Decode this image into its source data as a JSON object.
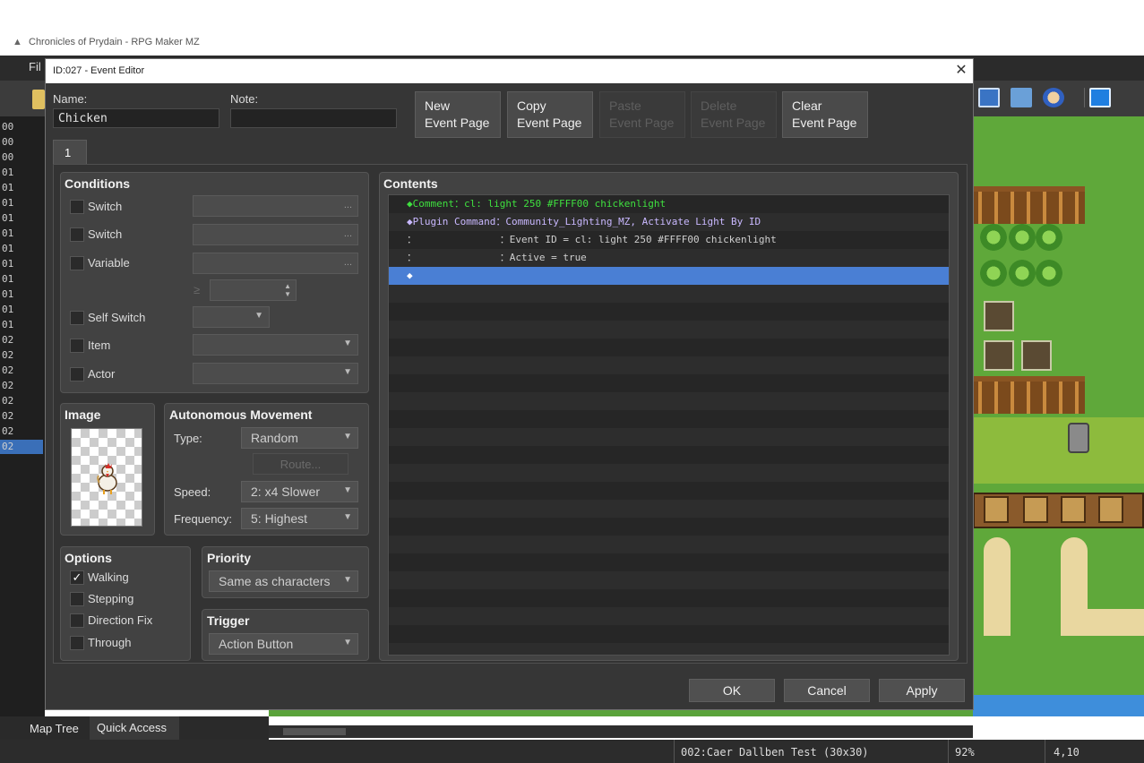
{
  "app": {
    "title": "Chronicles of Prydain - RPG Maker MZ",
    "menu_file": "Fil",
    "map_list": [
      "00",
      "00",
      "00",
      "01",
      "01",
      "01",
      "01",
      "01",
      "01",
      "01",
      "01",
      "01",
      "01",
      "01",
      "02",
      "02",
      "02",
      "02",
      "02",
      "02",
      "02",
      "02"
    ],
    "tabs": {
      "map_tree": "Map Tree",
      "quick_access": "Quick Access"
    },
    "status": {
      "map": "002:Caer Dallben Test (30x30)",
      "zoom": "92%",
      "coords": "4,10"
    }
  },
  "dialog": {
    "title": "ID:027 - Event Editor",
    "close": "✕",
    "name_label": "Name:",
    "name_value": "Chicken",
    "note_label": "Note:",
    "note_value": "",
    "page_buttons": [
      {
        "line1": "New",
        "line2": "Event Page",
        "enabled": true
      },
      {
        "line1": "Copy",
        "line2": "Event Page",
        "enabled": true
      },
      {
        "line1": "Paste",
        "line2": "Event Page",
        "enabled": false
      },
      {
        "line1": "Delete",
        "line2": "Event Page",
        "enabled": false
      },
      {
        "line1": "Clear",
        "line2": "Event Page",
        "enabled": true
      }
    ],
    "page_tab": "1",
    "conditions": {
      "title": "Conditions",
      "switch1": "Switch",
      "switch2": "Switch",
      "variable": "Variable",
      "self_switch": "Self Switch",
      "item": "Item",
      "actor": "Actor",
      "more": "...",
      "gte": "≥"
    },
    "image": {
      "title": "Image"
    },
    "movement": {
      "title": "Autonomous Movement",
      "type_label": "Type:",
      "type_value": "Random",
      "route_button": "Route...",
      "speed_label": "Speed:",
      "speed_value": "2: x4 Slower",
      "frequency_label": "Frequency:",
      "frequency_value": "5: Highest"
    },
    "options": {
      "title": "Options",
      "walking": "Walking",
      "walking_checked": true,
      "walking_mark": "✓",
      "stepping": "Stepping",
      "direction_fix": "Direction Fix",
      "through": "Through"
    },
    "priority": {
      "title": "Priority",
      "value": "Same as characters"
    },
    "trigger": {
      "title": "Trigger",
      "value": "Action Button"
    },
    "contents": {
      "title": "Contents",
      "lines": [
        {
          "text": "◆Comment：cl: light 250 #FFFF00 chickenlight",
          "color": "#3fe03f"
        },
        {
          "text": "◆Plugin Command：Community_Lighting_MZ, Activate Light By ID",
          "color": "#c9b8ff"
        },
        {
          "text": "：              ：Event ID = cl: light 250 #FFFF00 chickenlight",
          "color": "#cfcfcf"
        },
        {
          "text": "：              ：Active = true",
          "color": "#cfcfcf"
        },
        {
          "text": "◆",
          "color": "#ffffff"
        }
      ]
    },
    "footer": {
      "ok": "OK",
      "cancel": "Cancel",
      "apply": "Apply"
    }
  },
  "colors": {
    "accent_selection": "#4a7fd4",
    "comment_green": "#3fe03f",
    "plugin_purple": "#c9b8ff"
  }
}
